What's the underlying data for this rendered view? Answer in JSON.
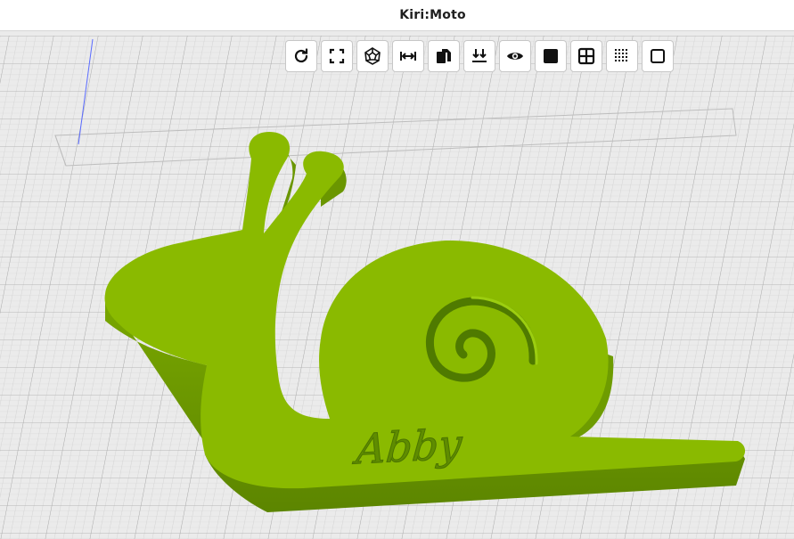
{
  "app": {
    "title": "Kiri:Moto"
  },
  "toolbar": {
    "buttons": [
      {
        "name": "rotate-button",
        "icon": "rotate-icon"
      },
      {
        "name": "fit-view-button",
        "icon": "expand-corners-icon"
      },
      {
        "name": "polyhedron-view-button",
        "icon": "dodecahedron-icon"
      },
      {
        "name": "measure-width-button",
        "icon": "arrows-horizontal-icon"
      },
      {
        "name": "duplicate-button",
        "icon": "copy-icon"
      },
      {
        "name": "lay-flat-button",
        "icon": "download-double-icon"
      },
      {
        "name": "visibility-button",
        "icon": "eye-icon"
      },
      {
        "name": "solid-view-button",
        "icon": "filled-square-icon"
      },
      {
        "name": "grid-view-button",
        "icon": "grid-square-icon"
      },
      {
        "name": "dotted-view-button",
        "icon": "dotted-square-icon"
      },
      {
        "name": "wireframe-view-button",
        "icon": "outline-square-icon"
      }
    ]
  },
  "model": {
    "engraved_text": "Abby",
    "color": "#8aba00",
    "side_color": "#6a9800"
  },
  "colors": {
    "platform": "#ebebeb",
    "grid_line": "#c4c4c4"
  }
}
